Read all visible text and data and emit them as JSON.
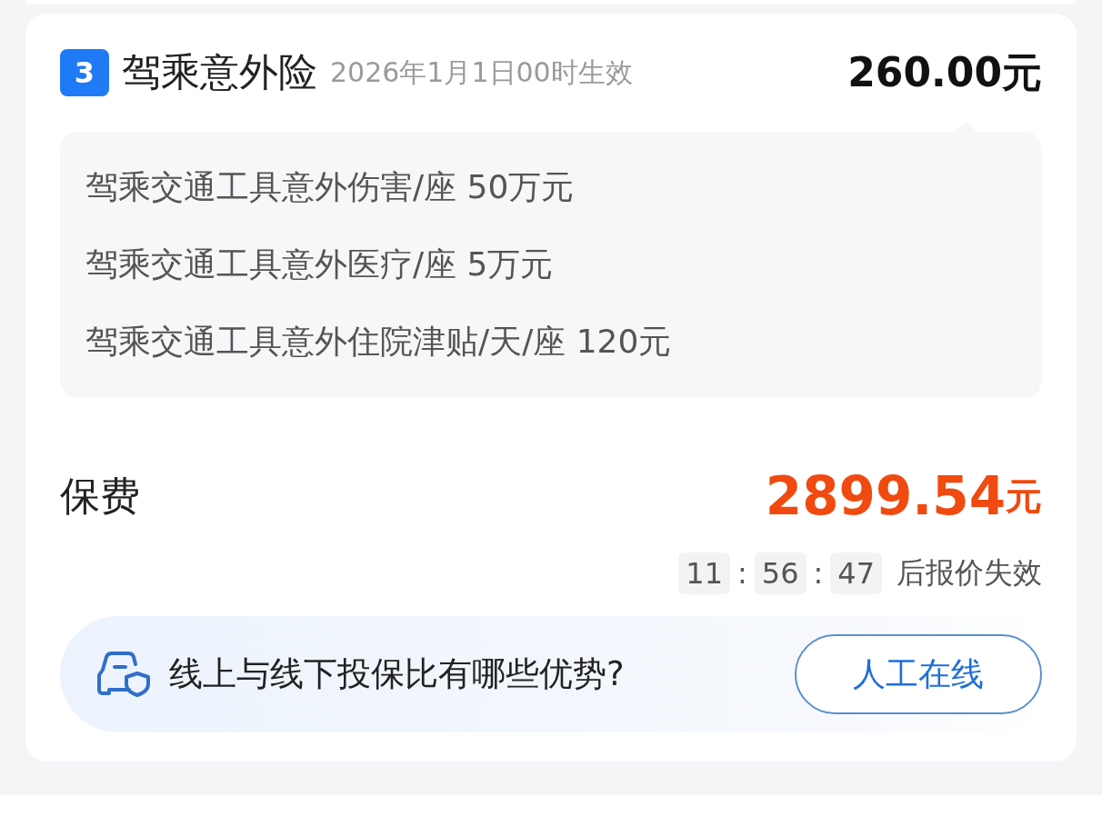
{
  "plan": {
    "number": "3",
    "name": "驾乘意外险",
    "effective": "2026年1月1日00时生效",
    "price": "260.00元",
    "coverages": [
      {
        "item": "驾乘交通工具意外伤害/座",
        "amount": "50万元"
      },
      {
        "item": "驾乘交通工具意外医疗/座",
        "amount": "5万元"
      },
      {
        "item": "驾乘交通工具意外住院津贴/天/座",
        "amount": "120元"
      }
    ]
  },
  "premium": {
    "label": "保费",
    "amount": "2899.54",
    "unit": "元"
  },
  "countdown": {
    "parts": [
      "11",
      "56",
      "47"
    ],
    "separator": ":",
    "suffix": "后报价失效"
  },
  "help": {
    "question": "线上与线下投保比有哪些优势?",
    "button": "人工在线"
  }
}
